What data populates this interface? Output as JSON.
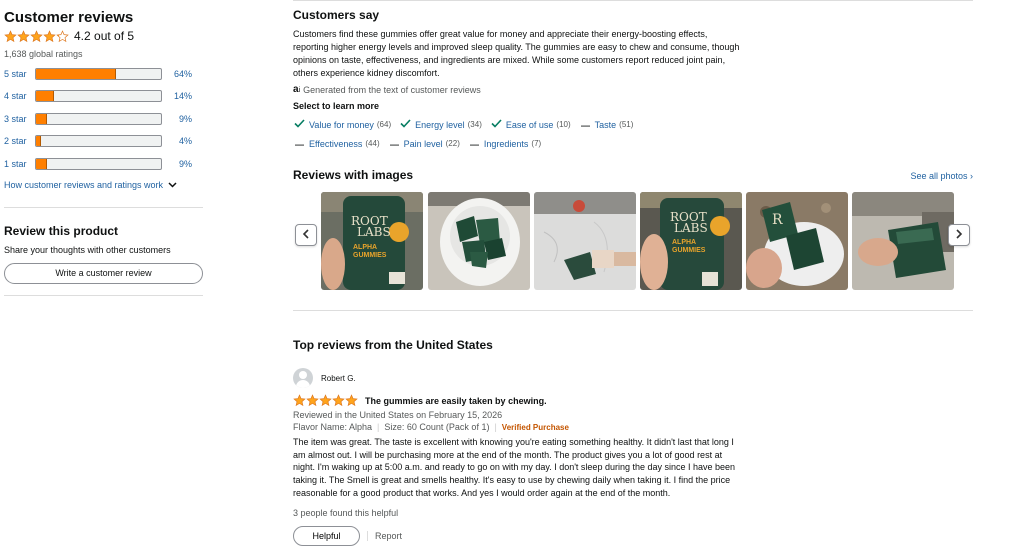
{
  "ratings": {
    "title": "Customer reviews",
    "stars_value": 4.2,
    "rating_text": "4.2 out of 5",
    "global_ratings": "1,638 global ratings",
    "histogram": [
      {
        "label": "5 star",
        "percent": 64,
        "percent_text": "64%"
      },
      {
        "label": "4 star",
        "percent": 14,
        "percent_text": "14%"
      },
      {
        "label": "3 star",
        "percent": 9,
        "percent_text": "9%"
      },
      {
        "label": "2 star",
        "percent": 4,
        "percent_text": "4%"
      },
      {
        "label": "1 star",
        "percent": 9,
        "percent_text": "9%"
      }
    ],
    "how_link": "How customer reviews and ratings work"
  },
  "review_product": {
    "title": "Review this product",
    "subtitle": "Share your thoughts with other customers",
    "button": "Write a customer review"
  },
  "customers_say": {
    "title": "Customers say",
    "summary": "Customers find these gummies offer great value for money and appreciate their energy-boosting effects, reporting higher energy levels and improved sleep quality. The gummies are easy to chew and consume, though opinions on taste, effectiveness, and ingredients are mixed. While some customers report reduced joint pain, others experience kidney discomfort.",
    "ai_icon": "a",
    "ai_note": "Generated from the text of customer reviews",
    "select_label": "Select to learn more",
    "aspects": [
      {
        "label": "Value for money",
        "count": "(64)",
        "sentiment": "positive"
      },
      {
        "label": "Energy level",
        "count": "(34)",
        "sentiment": "positive"
      },
      {
        "label": "Ease of use",
        "count": "(10)",
        "sentiment": "positive"
      },
      {
        "label": "Taste",
        "count": "(51)",
        "sentiment": "mixed"
      },
      {
        "label": "Effectiveness",
        "count": "(44)",
        "sentiment": "mixed"
      },
      {
        "label": "Pain level",
        "count": "(22)",
        "sentiment": "mixed"
      },
      {
        "label": "Ingredients",
        "count": "(7)",
        "sentiment": "mixed"
      }
    ]
  },
  "images_section": {
    "title": "Reviews with images",
    "see_all": "See all photos ›",
    "prev_icon": "chevron-left-icon",
    "next_icon": "chevron-right-icon",
    "thumbnails": [
      {
        "name": "root-labs-bottle-hand",
        "brand_top": "ROOT",
        "brand_bottom": "LABS",
        "product": "ALPHA\nGUMMIES"
      },
      {
        "name": "gummy-packets-in-jar"
      },
      {
        "name": "gummy-packet-on-counter"
      },
      {
        "name": "root-labs-bottle-hand-2",
        "brand_top": "ROOT",
        "brand_bottom": "LABS",
        "product": "ALPHA\nGUMMIES"
      },
      {
        "name": "gummy-packets-bowl",
        "letter": "R"
      },
      {
        "name": "open-gummy-packet"
      }
    ]
  },
  "top_reviews": {
    "title": "Top reviews from the United States",
    "review": {
      "user": "Robert G.",
      "stars": 5,
      "title": "The gummies are easily taken by chewing.",
      "meta": "Reviewed in the United States on February 15, 2026",
      "flavor": "Flavor Name: Alpha",
      "size": "Size: 60 Count (Pack of 1)",
      "verified": "Verified Purchase",
      "body": "The item was great. The taste is excellent with knowing you're eating something healthy. It didn't last that long I am almost out. I will be purchasing more at the end of the month. The product gives you a lot of good rest at night. I'm waking up at 5:00 a.m. and ready to go on with my day. I don't sleep during the day since I have been taking it. The Smell is great and smells healthy. It's easy to use by chewing daily when taking it. I find the price reasonable for a good product that works. And yes I would order again at the end of the month.",
      "helpful_count": "3 people found this helpful",
      "helpful_button": "Helpful",
      "report": "Report"
    }
  },
  "colors": {
    "star": "#ffa41c",
    "bar_fill": "#ff7f00",
    "link": "#2162a1",
    "verified": "#c45500",
    "check": "#067d62"
  }
}
